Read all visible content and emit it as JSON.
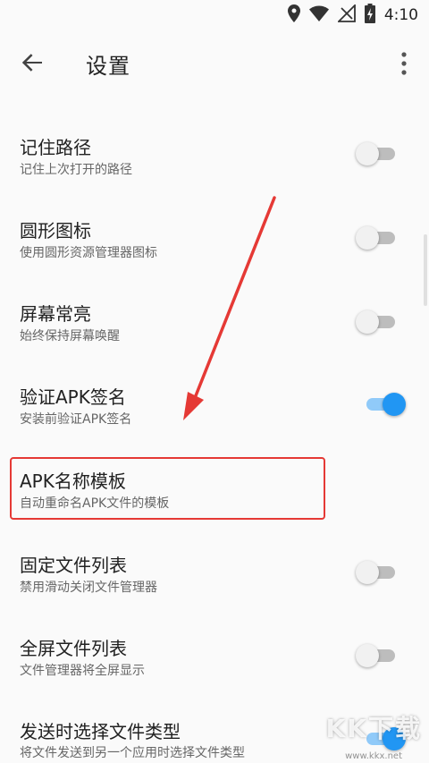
{
  "status": {
    "time": "4:10"
  },
  "toolbar": {
    "title": "设置"
  },
  "settings": [
    {
      "title": "记住路径",
      "subtitle": "记住上次打开的路径",
      "enabled": false
    },
    {
      "title": "圆形图标",
      "subtitle": "使用圆形资源管理器图标",
      "enabled": false
    },
    {
      "title": "屏幕常亮",
      "subtitle": "始终保持屏幕唤醒",
      "enabled": false
    },
    {
      "title": "验证APK签名",
      "subtitle": "安装前验证APK签名",
      "enabled": true
    },
    {
      "title": "APK名称模板",
      "subtitle": "自动重命名APK文件的模板"
    },
    {
      "title": "固定文件列表",
      "subtitle": "禁用滑动关闭文件管理器",
      "enabled": false
    },
    {
      "title": "全屏文件列表",
      "subtitle": "文件管理器将全屏显示",
      "enabled": false
    },
    {
      "title": "发送时选择文件类型",
      "subtitle": "将文件发送到另一个应用时选择文件类型",
      "enabled": true
    }
  ],
  "colors": {
    "accent": "#2196f3",
    "annotation": "#e53935"
  },
  "watermark": {
    "text": "KK下载",
    "url": "www.kkx.net"
  }
}
